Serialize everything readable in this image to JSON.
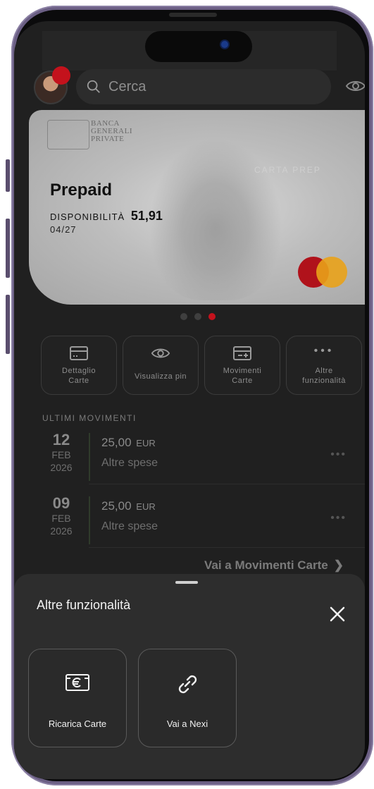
{
  "header": {
    "search_placeholder": "Cerca"
  },
  "card": {
    "bank_name": "BANCA\nGENERALI\nPRIVATE",
    "tag": "CARTA PREP",
    "title": "Prepaid",
    "availability_label": "DISPONIBILITÀ",
    "availability_value": "51,91",
    "expiry": "04/27",
    "pager": {
      "count": 3,
      "active_index": 2
    }
  },
  "quick_actions": [
    {
      "label": "Dettaglio\nCarte",
      "icon": "card-detail-icon"
    },
    {
      "label": "Visualizza pin",
      "icon": "eye-icon"
    },
    {
      "label": "Movimenti\nCarte",
      "icon": "card-movements-icon"
    },
    {
      "label": "Altre\nfunzionalità",
      "icon": "more-dots-icon"
    }
  ],
  "movements": {
    "section_title": "ULTIMI MOVIMENTI",
    "items": [
      {
        "day": "12",
        "month": "FEB",
        "year": "2026",
        "amount": "25,00",
        "currency": "EUR",
        "description": "Altre spese"
      },
      {
        "day": "09",
        "month": "FEB",
        "year": "2026",
        "amount": "25,00",
        "currency": "EUR",
        "description": "Altre spese"
      }
    ],
    "goto_link": "Vai a Movimenti Carte"
  },
  "sheet": {
    "title": "Altre funzionalità",
    "options": [
      {
        "label": "Ricarica Carte",
        "icon": "euro-card-icon"
      },
      {
        "label": "Vai a Nexi",
        "icon": "link-icon"
      }
    ]
  },
  "colors": {
    "accent_red": "#c4121c",
    "mastercard_red": "#b0121b",
    "mastercard_yellow": "#e9a21a",
    "sheet_bg": "#2d2d2d",
    "screen_bg": "#202020"
  }
}
